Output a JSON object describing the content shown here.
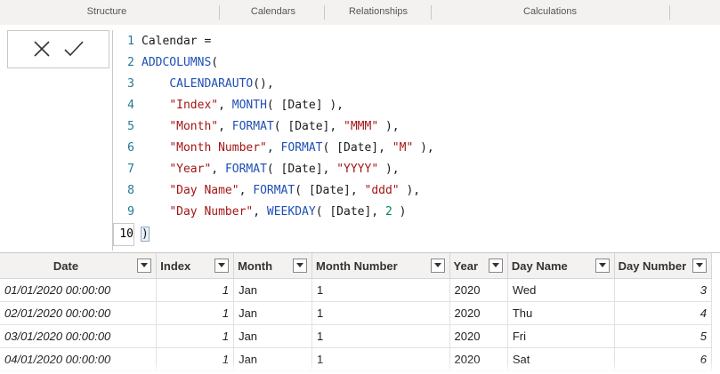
{
  "ribbon": {
    "groups": [
      "Structure",
      "Calendars",
      "Relationships",
      "Calculations"
    ]
  },
  "formula_bar": {
    "cancel_icon": "close-icon",
    "commit_icon": "checkmark-icon",
    "lines": [
      {
        "n": "1",
        "tokens": [
          {
            "t": "Calendar =",
            "c": "ident"
          }
        ]
      },
      {
        "n": "2",
        "tokens": [
          {
            "t": "ADDCOLUMNS",
            "c": "func"
          },
          {
            "t": "(",
            "c": "ident"
          }
        ]
      },
      {
        "n": "3",
        "tokens": [
          {
            "t": "    ",
            "c": "ident"
          },
          {
            "t": "CALENDARAUTO",
            "c": "func"
          },
          {
            "t": "(),",
            "c": "ident"
          }
        ]
      },
      {
        "n": "4",
        "tokens": [
          {
            "t": "    ",
            "c": "ident"
          },
          {
            "t": "\"Index\"",
            "c": "str"
          },
          {
            "t": ", ",
            "c": "ident"
          },
          {
            "t": "MONTH",
            "c": "func"
          },
          {
            "t": "( [Date] ),",
            "c": "ident"
          }
        ]
      },
      {
        "n": "5",
        "tokens": [
          {
            "t": "    ",
            "c": "ident"
          },
          {
            "t": "\"Month\"",
            "c": "str"
          },
          {
            "t": ", ",
            "c": "ident"
          },
          {
            "t": "FORMAT",
            "c": "func"
          },
          {
            "t": "( [Date], ",
            "c": "ident"
          },
          {
            "t": "\"MMM\"",
            "c": "str"
          },
          {
            "t": " ),",
            "c": "ident"
          }
        ]
      },
      {
        "n": "6",
        "tokens": [
          {
            "t": "    ",
            "c": "ident"
          },
          {
            "t": "\"Month Number\"",
            "c": "str"
          },
          {
            "t": ", ",
            "c": "ident"
          },
          {
            "t": "FORMAT",
            "c": "func"
          },
          {
            "t": "( [Date], ",
            "c": "ident"
          },
          {
            "t": "\"M\"",
            "c": "str"
          },
          {
            "t": " ),",
            "c": "ident"
          }
        ]
      },
      {
        "n": "7",
        "tokens": [
          {
            "t": "    ",
            "c": "ident"
          },
          {
            "t": "\"Year\"",
            "c": "str"
          },
          {
            "t": ", ",
            "c": "ident"
          },
          {
            "t": "FORMAT",
            "c": "func"
          },
          {
            "t": "( [Date], ",
            "c": "ident"
          },
          {
            "t": "\"YYYY\"",
            "c": "str"
          },
          {
            "t": " ),",
            "c": "ident"
          }
        ]
      },
      {
        "n": "8",
        "tokens": [
          {
            "t": "    ",
            "c": "ident"
          },
          {
            "t": "\"Day Name\"",
            "c": "str"
          },
          {
            "t": ", ",
            "c": "ident"
          },
          {
            "t": "FORMAT",
            "c": "func"
          },
          {
            "t": "( [Date], ",
            "c": "ident"
          },
          {
            "t": "\"ddd\"",
            "c": "str"
          },
          {
            "t": " ),",
            "c": "ident"
          }
        ]
      },
      {
        "n": "9",
        "tokens": [
          {
            "t": "    ",
            "c": "ident"
          },
          {
            "t": "\"Day Number\"",
            "c": "str"
          },
          {
            "t": ", ",
            "c": "ident"
          },
          {
            "t": "WEEKDAY",
            "c": "func"
          },
          {
            "t": "( [Date], ",
            "c": "ident"
          },
          {
            "t": "2",
            "c": "num"
          },
          {
            "t": " )",
            "c": "ident"
          }
        ]
      },
      {
        "n": "10",
        "tokens": [
          {
            "t": ")",
            "c": "cursorp"
          }
        ]
      }
    ]
  },
  "table": {
    "columns": [
      {
        "label": "Date",
        "align": "center"
      },
      {
        "label": "Index",
        "align": "left"
      },
      {
        "label": "Month",
        "align": "left"
      },
      {
        "label": "Month Number",
        "align": "left"
      },
      {
        "label": "Year",
        "align": "left"
      },
      {
        "label": "Day Name",
        "align": "left"
      },
      {
        "label": "Day Number",
        "align": "left"
      }
    ],
    "rows": [
      [
        "01/01/2020 00:00:00",
        "1",
        "Jan",
        "1",
        "2020",
        "Wed",
        "3"
      ],
      [
        "02/01/2020 00:00:00",
        "1",
        "Jan",
        "1",
        "2020",
        "Thu",
        "4"
      ],
      [
        "03/01/2020 00:00:00",
        "1",
        "Jan",
        "1",
        "2020",
        "Fri",
        "5"
      ],
      [
        "04/01/2020 00:00:00",
        "1",
        "Jan",
        "1",
        "2020",
        "Sat",
        "6"
      ]
    ]
  }
}
